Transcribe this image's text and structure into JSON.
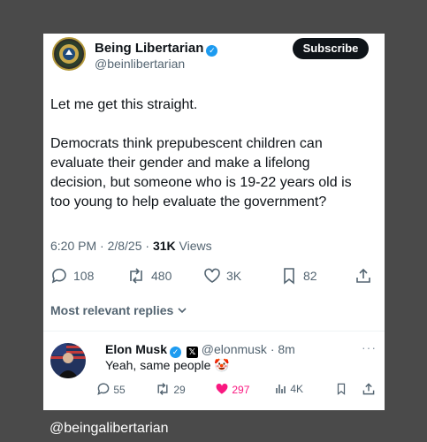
{
  "tweet": {
    "author_name": "Being Libertarian",
    "author_handle": "@beinlibertarian",
    "subscribe_label": "Subscribe",
    "text_line1": "Let me get this straight.",
    "text_p2_l1": "Democrats think prepubescent children can",
    "text_p2_l2": "evaluate their gender and make a lifelong",
    "text_p2_l3": "decision, but someone who is 19-22 years old is",
    "text_p2_l4": "too young to help evaluate the government?",
    "time": "6:20 PM · 2/8/25 · ",
    "views_count": "31K",
    "views_label": " Views",
    "replies": "108",
    "reposts": "480",
    "likes": "3K",
    "bookmarks": "82"
  },
  "sort": {
    "label": "Most relevant replies"
  },
  "reply": {
    "author_name": "Elon Musk",
    "author_handle": "@elonmusk · 8m",
    "text": "Yeah, same people 🤡",
    "replies": "55",
    "reposts": "29",
    "likes": "297",
    "views": "4K"
  },
  "watermark": "@beingalibertarian",
  "colors": {
    "like_pink": "#f91880",
    "verified_blue": "#1d9bf0",
    "text_gray": "#536471"
  }
}
